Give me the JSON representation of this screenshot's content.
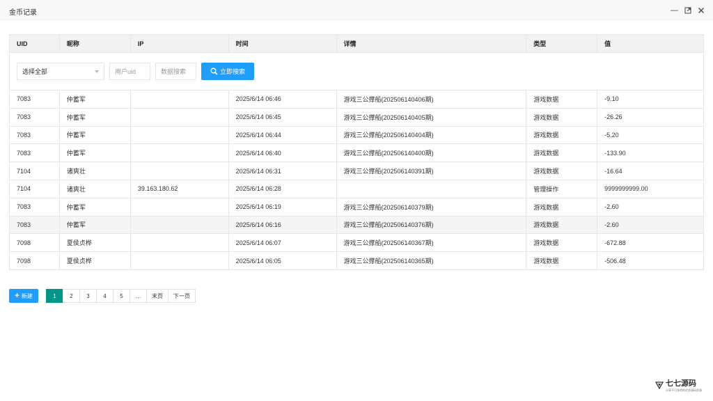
{
  "window": {
    "title": "金币记录"
  },
  "table": {
    "columns": [
      "UID",
      "昵称",
      "IP",
      "时间",
      "详情",
      "类型",
      "值"
    ],
    "rows": [
      {
        "uid": "7083",
        "nick": "仲蓄军",
        "ip": "",
        "time": "2025/6/14 06:46",
        "detail": "游戏三公撑船(202506140406期)",
        "type": "游戏数据",
        "value": "-9.10",
        "tone": "neg"
      },
      {
        "uid": "7083",
        "nick": "仲蓄军",
        "ip": "",
        "time": "2025/6/14 06:45",
        "detail": "游戏三公撑船(202506140405期)",
        "type": "游戏数据",
        "value": "-26.26",
        "tone": "neg"
      },
      {
        "uid": "7083",
        "nick": "仲蓄军",
        "ip": "",
        "time": "2025/6/14 06:44",
        "detail": "游戏三公撑船(202506140404期)",
        "type": "游戏数据",
        "value": "-5.20",
        "tone": "neg"
      },
      {
        "uid": "7083",
        "nick": "仲蓄军",
        "ip": "",
        "time": "2025/6/14 06:40",
        "detail": "游戏三公撑船(202506140400期)",
        "type": "游戏数据",
        "value": "-133.90",
        "tone": "neg"
      },
      {
        "uid": "7104",
        "nick": "诸爽壮",
        "ip": "",
        "time": "2025/6/14 06:31",
        "detail": "游戏三公撑船(202506140391期)",
        "type": "游戏数据",
        "value": "-16.64",
        "tone": "neg"
      },
      {
        "uid": "7104",
        "nick": "诸爽壮",
        "ip": "39.163.180.62",
        "time": "2025/6/14 06:28",
        "detail": "",
        "type": "管理操作",
        "value": "9999999999.00",
        "tone": "pos"
      },
      {
        "uid": "7083",
        "nick": "仲蓄军",
        "ip": "",
        "time": "2025/6/14 06:19",
        "detail": "游戏三公撑船(202506140379期)",
        "type": "游戏数据",
        "value": "-2.60",
        "tone": "neg"
      },
      {
        "uid": "7083",
        "nick": "仲蓄军",
        "ip": "",
        "time": "2025/6/14 06:16",
        "detail": "游戏三公撑船(202506140376期)",
        "type": "游戏数据",
        "value": "-2.60",
        "tone": "neg"
      },
      {
        "uid": "7098",
        "nick": "夏侯贞桦",
        "ip": "",
        "time": "2025/6/14 06:07",
        "detail": "游戏三公撑船(202506140367期)",
        "type": "游戏数据",
        "value": "-672.88",
        "tone": "neg"
      },
      {
        "uid": "7098",
        "nick": "夏侯贞桦",
        "ip": "",
        "time": "2025/6/14 06:05",
        "detail": "游戏三公撑船(202506140365期)",
        "type": "游戏数据",
        "value": "-506.48",
        "tone": "neg"
      }
    ],
    "hover_row_index": 7
  },
  "filters": {
    "select_value": "选择全部",
    "uid_placeholder": "用户uid",
    "data_placeholder": "数据搜索",
    "search_label": "立即搜索"
  },
  "actions": {
    "new_label": "新建"
  },
  "pager": {
    "pages": [
      "1",
      "2",
      "3",
      "4",
      "5",
      "…",
      "末页",
      "下一页"
    ],
    "active": "1"
  },
  "watermark": {
    "text": "七七源码",
    "sub": "分享不可多得的优质源码资源"
  },
  "colors": {
    "accent": "#1e9fff",
    "pager_active": "#009688",
    "negative": "#f02a2a",
    "positive": "#009900"
  }
}
